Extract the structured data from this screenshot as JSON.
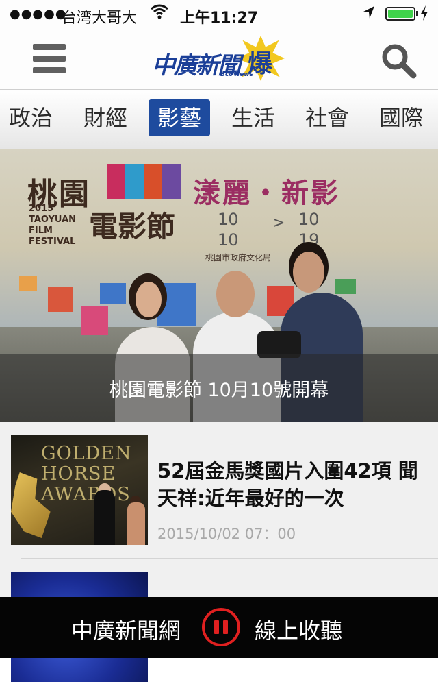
{
  "status_bar": {
    "signal_dots": "●●●●●",
    "carrier": "台湾大哥大",
    "time": "上午11:27",
    "battery_level": 1.0
  },
  "header": {
    "logo_text": "中廣新聞",
    "logo_burst": "爆",
    "logo_sub": "Bcc News"
  },
  "tabs": [
    {
      "label": "政治",
      "active": false
    },
    {
      "label": "財經",
      "active": false
    },
    {
      "label": "影藝",
      "active": true
    },
    {
      "label": "生活",
      "active": false
    },
    {
      "label": "社會",
      "active": false
    },
    {
      "label": "國際",
      "active": false
    }
  ],
  "hero": {
    "banner_title": "桃園",
    "banner_slogan": "漾麗・新影",
    "banner_year": "2015",
    "banner_en": [
      "TAOYUAN",
      "FILM",
      "FESTIVAL"
    ],
    "banner_fest": "電影節",
    "banner_date_start": [
      "10",
      "10"
    ],
    "banner_date_end": [
      "10",
      "19"
    ],
    "banner_org": "桃園市政府文化局",
    "caption": "桃園電影節  10月10號開幕"
  },
  "articles": [
    {
      "title": "52屆金馬獎國片入圍42項 聞天祥:近年最好的一次",
      "date": "2015/10/02 07：00",
      "thumb_text": [
        "GOLDEN",
        "HORSE",
        "AWARDS"
      ]
    },
    {
      "title": "",
      "date": ""
    }
  ],
  "player": {
    "station": "中廣新聞網",
    "listen": "線上收聽"
  },
  "colors": {
    "brand_blue": "#1e4b9e",
    "pause_red": "#e02020",
    "battery_green": "#3fd24a"
  }
}
